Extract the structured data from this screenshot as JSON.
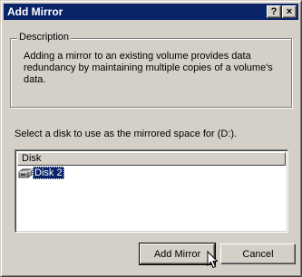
{
  "window": {
    "title": "Add Mirror",
    "help_button": "?",
    "close_button": "×"
  },
  "description": {
    "legend": "Description",
    "text": "Adding a mirror to an existing volume provides data redundancy by maintaining multiple copies of a volume's data."
  },
  "prompt": "Select a disk to use as the mirrored space for  (D:).",
  "disk_list": {
    "columns": [
      "Disk"
    ],
    "rows": [
      {
        "label": "Disk 2",
        "icon": "disk-drive-icon",
        "selected": true
      }
    ]
  },
  "buttons": {
    "add_mirror": "Add Mirror",
    "cancel": "Cancel"
  },
  "colors": {
    "titlebar": "#0a246a",
    "face": "#d4d0c8",
    "selection": "#0a246a"
  }
}
